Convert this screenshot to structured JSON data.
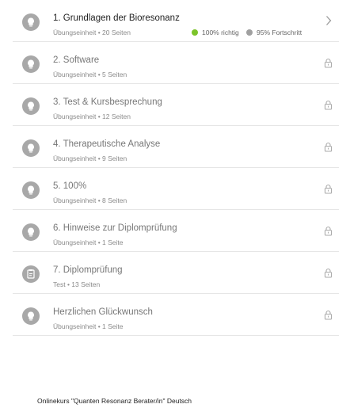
{
  "modules": [
    {
      "title": "1. Grundlagen der Bioresonanz",
      "subtitle": "Übungseinheit • 20 Seiten",
      "icon": "bulb-icon",
      "status": "open",
      "correct": "100% richtig",
      "progress": "95% Fortschritt",
      "correct_color": "#7cc42a",
      "progress_color": "#a0a0a0",
      "trail_icon": "chevron-right-icon"
    },
    {
      "title": "2. Software",
      "subtitle": "Übungseinheit • 5 Seiten",
      "icon": "bulb-icon",
      "status": "locked",
      "trail_icon": "lock-icon"
    },
    {
      "title": "3. Test & Kursbesprechung",
      "subtitle": "Übungseinheit • 12 Seiten",
      "icon": "bulb-icon",
      "status": "locked",
      "trail_icon": "lock-icon"
    },
    {
      "title": "4. Therapeutische Analyse",
      "subtitle": "Übungseinheit • 9 Seiten",
      "icon": "bulb-icon",
      "status": "locked",
      "trail_icon": "lock-icon"
    },
    {
      "title": "5. 100%",
      "subtitle": "Übungseinheit • 8 Seiten",
      "icon": "bulb-icon",
      "status": "locked",
      "trail_icon": "lock-icon"
    },
    {
      "title": "6. Hinweise zur Diplomprüfung",
      "subtitle": "Übungseinheit • 1 Seite",
      "icon": "bulb-icon",
      "status": "locked",
      "trail_icon": "lock-icon"
    },
    {
      "title": "7. Diplomprüfung",
      "subtitle": "Test • 13 Seiten",
      "icon": "test-icon",
      "status": "locked",
      "trail_icon": "lock-icon"
    },
    {
      "title": "Herzlichen Glückwunsch",
      "subtitle": "Übungseinheit • 1 Seite",
      "icon": "bulb-icon",
      "status": "locked",
      "trail_icon": "lock-icon"
    }
  ],
  "footer": {
    "text": "Onlinekurs \"Quanten Resonanz Berater/in\" Deutsch"
  },
  "colors": {
    "icon_bg": "#a8a8a8",
    "divider": "#e6e6e6"
  }
}
